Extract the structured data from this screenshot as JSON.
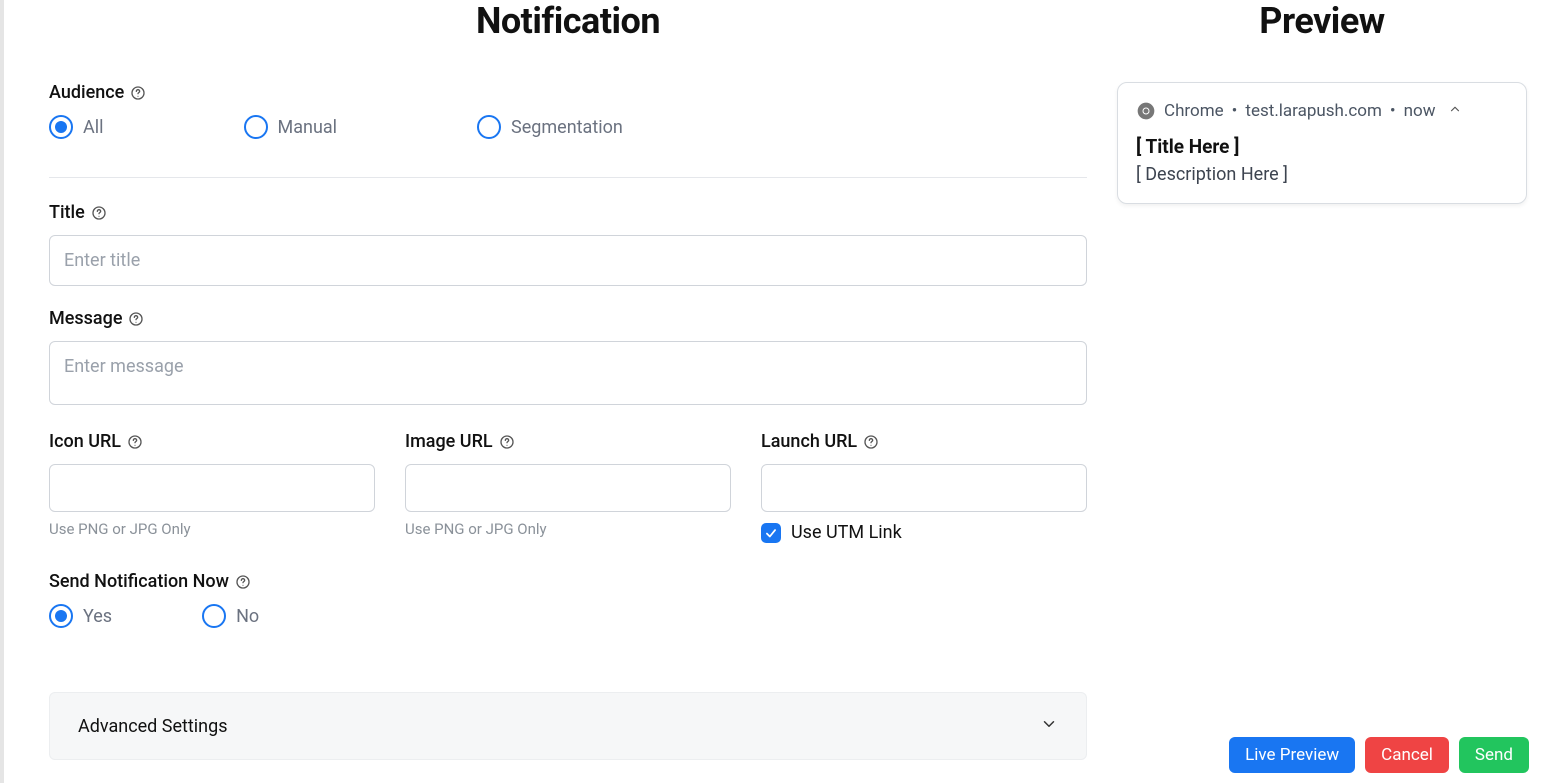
{
  "headings": {
    "notification": "Notification",
    "preview": "Preview"
  },
  "audience": {
    "label": "Audience",
    "options": {
      "all": "All",
      "manual": "Manual",
      "segmentation": "Segmentation"
    }
  },
  "title_field": {
    "label": "Title",
    "placeholder": "Enter title"
  },
  "message_field": {
    "label": "Message",
    "placeholder": "Enter message"
  },
  "icon_url": {
    "label": "Icon URL",
    "hint": "Use PNG or JPG Only"
  },
  "image_url": {
    "label": "Image URL",
    "hint": "Use PNG or JPG Only"
  },
  "launch_url": {
    "label": "Launch URL",
    "utm_label": "Use UTM Link"
  },
  "send_now": {
    "label": "Send Notification Now",
    "yes": "Yes",
    "no": "No"
  },
  "advanced": {
    "title": "Advanced Settings"
  },
  "preview_card": {
    "browser": "Chrome",
    "domain": "test.larapush.com",
    "time": "now",
    "title": "[ Title Here ]",
    "description": "[ Description Here ]"
  },
  "buttons": {
    "live_preview": "Live Preview",
    "cancel": "Cancel",
    "send": "Send"
  }
}
